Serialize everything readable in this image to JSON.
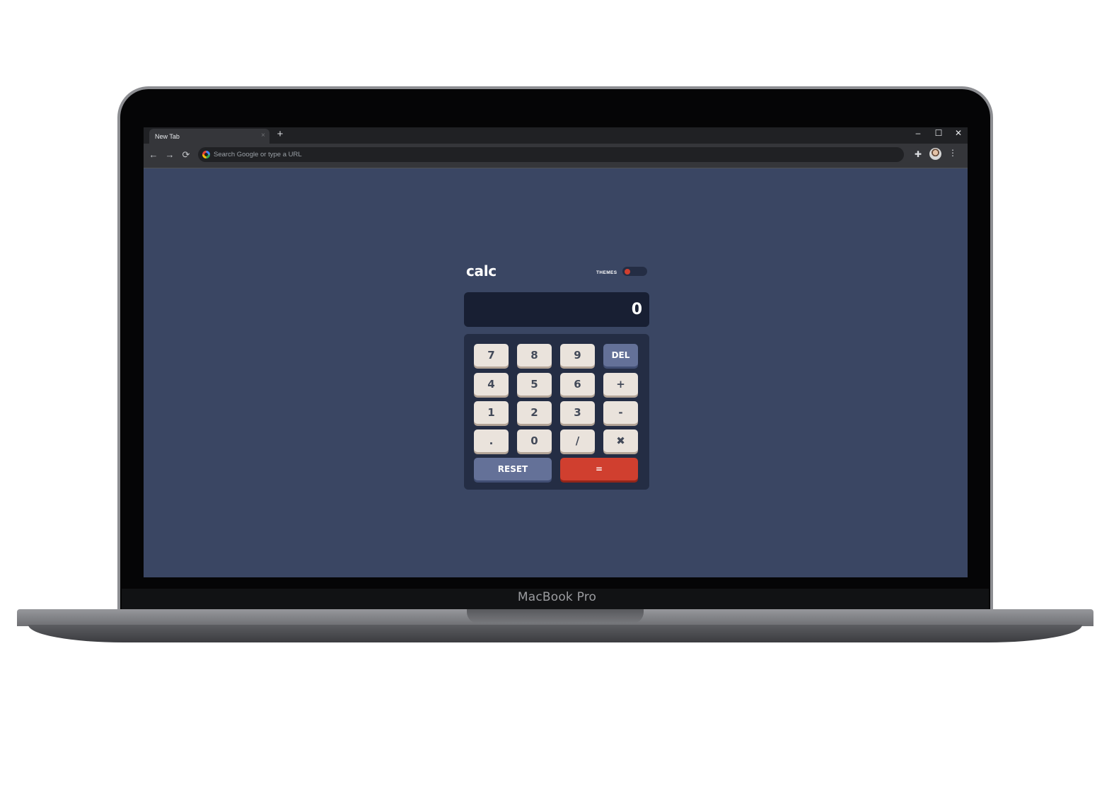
{
  "device": {
    "model_label": "MacBook Pro"
  },
  "browser": {
    "tab_title": "New Tab",
    "tab_close": "×",
    "new_tab": "+",
    "window_controls": {
      "minimize": "–",
      "maximize": "☐",
      "close": "✕"
    },
    "nav": {
      "back": "←",
      "forward": "→",
      "reload": "⟳"
    },
    "omnibox_placeholder": "Search Google or type a URL",
    "extensions_icon": "✚",
    "menu_icon": "⋮"
  },
  "calculator": {
    "brand": "calc",
    "themes_label": "THEMES",
    "active_theme": 1,
    "display_value": "0",
    "keys": {
      "k7": "7",
      "k8": "8",
      "k9": "9",
      "del": "DEL",
      "k4": "4",
      "k5": "5",
      "k6": "6",
      "plus": "+",
      "k1": "1",
      "k2": "2",
      "k3": "3",
      "minus": "-",
      "dot": ".",
      "k0": "0",
      "divide": "/",
      "multiply": "✖",
      "reset": "RESET",
      "equals": "="
    },
    "colors": {
      "background": "#3a4663",
      "keypad": "#242d44",
      "display": "#181f33",
      "key": "#eae3dc",
      "key_dark": "#647198",
      "key_accent": "#d03f2f"
    }
  }
}
